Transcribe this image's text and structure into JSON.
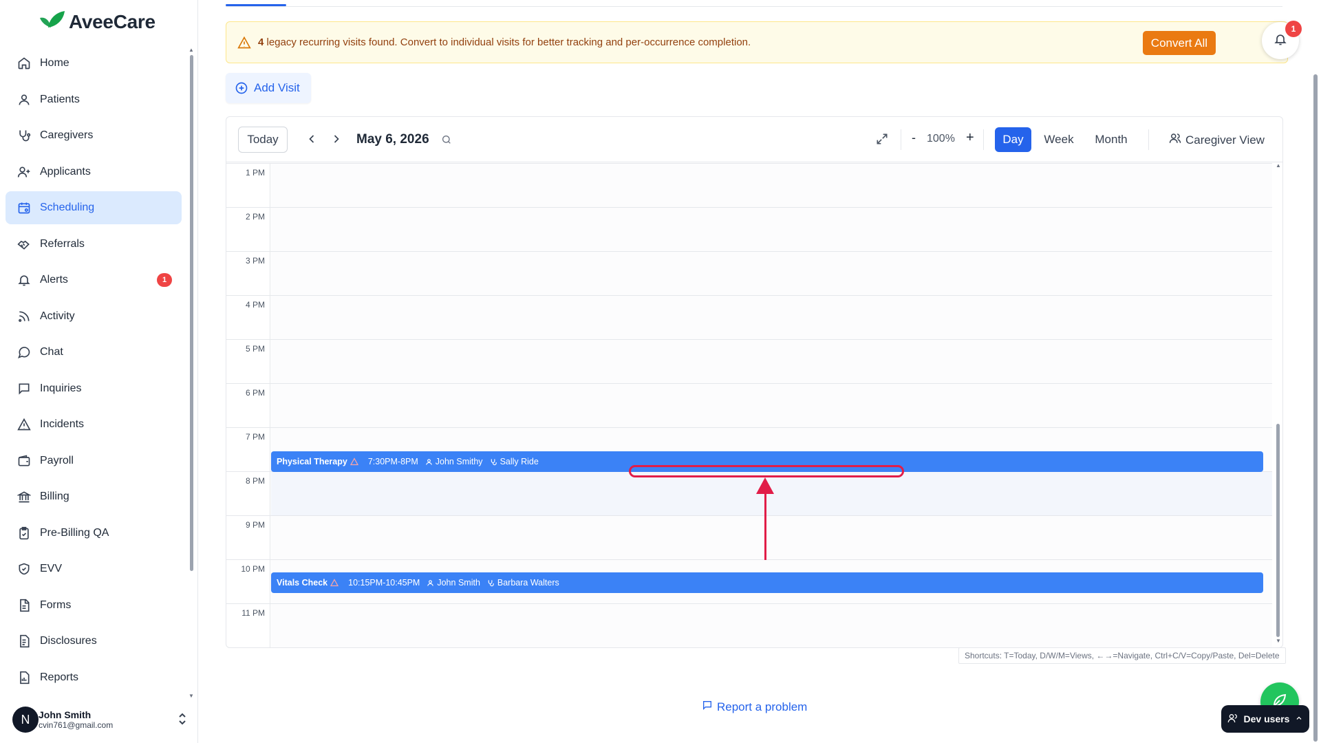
{
  "app": {
    "brand": "AveeCare",
    "brand_color": "#22a355"
  },
  "sidebar": {
    "items": [
      {
        "label": "Home",
        "icon": "home-icon"
      },
      {
        "label": "Patients",
        "icon": "user-icon"
      },
      {
        "label": "Caregivers",
        "icon": "stethoscope-icon"
      },
      {
        "label": "Applicants",
        "icon": "user-plus-icon"
      },
      {
        "label": "Scheduling",
        "icon": "calendar-icon",
        "active": true
      },
      {
        "label": "Referrals",
        "icon": "handshake-icon"
      },
      {
        "label": "Alerts",
        "icon": "bell-icon",
        "badge": "1"
      },
      {
        "label": "Activity",
        "icon": "rss-icon"
      },
      {
        "label": "Chat",
        "icon": "chat-bubble-icon"
      },
      {
        "label": "Inquiries",
        "icon": "message-square-icon"
      },
      {
        "label": "Incidents",
        "icon": "warning-triangle-icon"
      },
      {
        "label": "Payroll",
        "icon": "wallet-icon"
      },
      {
        "label": "Billing",
        "icon": "bank-icon"
      },
      {
        "label": "Pre-Billing QA",
        "icon": "clipboard-check-icon"
      },
      {
        "label": "EVV",
        "icon": "shield-check-icon"
      },
      {
        "label": "Forms",
        "icon": "file-icon"
      },
      {
        "label": "Disclosures",
        "icon": "file-text-icon"
      },
      {
        "label": "Reports",
        "icon": "report-icon"
      }
    ],
    "user": {
      "initial": "N",
      "name": "John Smith",
      "email": "cvin761@gmail.com"
    }
  },
  "banner": {
    "count": "4",
    "message": " legacy recurring visits found. Convert to individual visits for better tracking and per-occurrence completion.",
    "button": "Convert All"
  },
  "notifications": {
    "count": "1"
  },
  "add_visit": "Add Visit",
  "calendar": {
    "today": "Today",
    "date": "May 6, 2026",
    "zoom_minus": "-",
    "zoom": "100%",
    "zoom_plus": "+",
    "views": [
      "Day",
      "Week",
      "Month"
    ],
    "active_view": "Day",
    "caregiver_view": "Caregiver View",
    "hours": [
      "1 PM",
      "2 PM",
      "3 PM",
      "4 PM",
      "5 PM",
      "6 PM",
      "7 PM",
      "8 PM",
      "9 PM",
      "10 PM",
      "11 PM"
    ],
    "events": [
      {
        "title": "Physical Therapy",
        "time": "7:30PM-8PM",
        "patient": "John Smithy",
        "caregiver": "Sally Ride"
      },
      {
        "title": "Vitals Check",
        "time": "10:15PM-10:45PM",
        "patient": "John Smith",
        "caregiver": "Barbara Walters"
      }
    ],
    "event_color": "#3b82f6",
    "shortcuts": "Shortcuts: T=Today, D/W/M=Views, ←→=Navigate, Ctrl+C/V=Copy/Paste, Del=Delete"
  },
  "footer": {
    "report": "Report a problem",
    "dev_users": "Dev users"
  },
  "colors": {
    "accent": "#2563eb",
    "warning": "#ea7a12",
    "annotation": "#e11d48"
  }
}
